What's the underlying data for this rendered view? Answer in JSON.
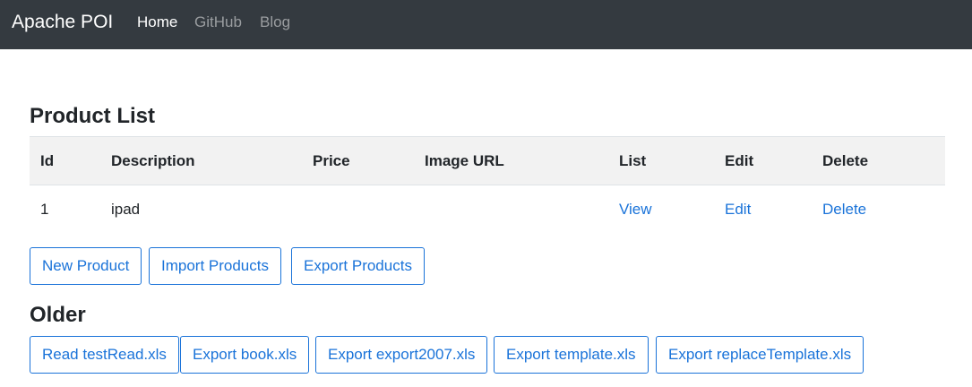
{
  "navbar": {
    "brand": "Apache POI",
    "links": [
      {
        "label": "Home"
      },
      {
        "label": "GitHub"
      },
      {
        "label": "Blog"
      }
    ]
  },
  "product_section": {
    "title": "Product List",
    "columns": [
      "Id",
      "Description",
      "Price",
      "Image URL",
      "List",
      "Edit",
      "Delete"
    ],
    "rows": [
      {
        "id": "1",
        "description": "ipad",
        "price": "",
        "image_url": "",
        "list": "View",
        "edit": "Edit",
        "delete": "Delete"
      }
    ],
    "buttons": [
      "New Product",
      "Import Products",
      "Export Products"
    ]
  },
  "older_section": {
    "title": "Older",
    "buttons": [
      "Read testRead.xls",
      "Export book.xls",
      "Export export2007.xls",
      "Export template.xls",
      "Export replaceTemplate.xls"
    ]
  }
}
